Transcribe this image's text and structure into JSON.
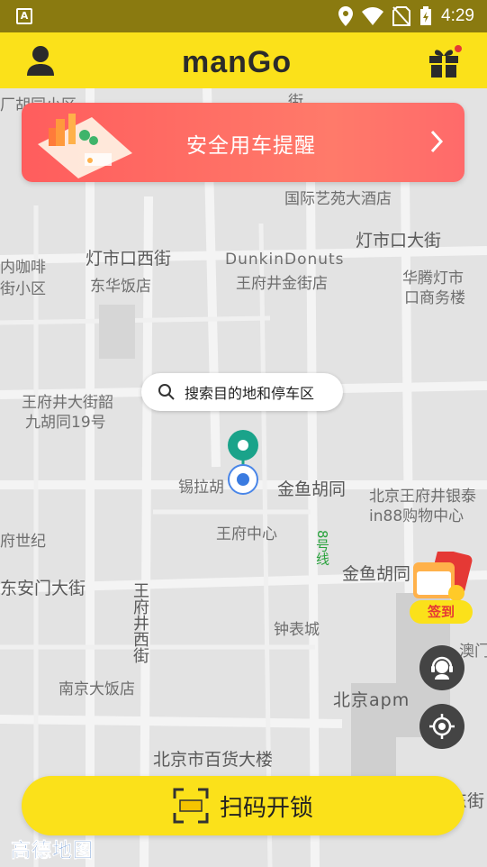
{
  "status_bar": {
    "left_icon": "A",
    "time": "4:29",
    "icons": [
      "location-icon",
      "wifi-icon",
      "no-sim-icon",
      "battery-icon"
    ]
  },
  "header": {
    "logo": "manGo",
    "brand_color": "#fbe11a",
    "user_icon": "user-icon",
    "gift_icon": "gift-icon"
  },
  "banner": {
    "text": "安全用车提醒",
    "color": "#ff5d5d"
  },
  "search": {
    "placeholder": "搜索目的地和停车区"
  },
  "map_labels": [
    "国际艺苑大酒店",
    "灯市口西街",
    "DunkinDonuts",
    "王府井金街店",
    "灯市口大街",
    "华腾灯市",
    "口商务楼",
    "东华饭店",
    "内咖啡",
    "街小区",
    "王府井大街韶",
    "九胡同19号",
    "锡拉胡",
    "金鱼胡同",
    "北京王府井银泰",
    "in88购物中心",
    "王府中心",
    "府世纪",
    "东安门大街",
    "王府井西街",
    "8号线",
    "金鱼胡同",
    "钟表城",
    "澳门",
    "南京大饭店",
    "北京apm",
    "北京市百货大楼",
    "厂胡同小区",
    "街",
    "东街"
  ],
  "signin": {
    "label": "签到"
  },
  "scan_button": {
    "label": "扫码开锁"
  },
  "map_provider": "高德地图"
}
